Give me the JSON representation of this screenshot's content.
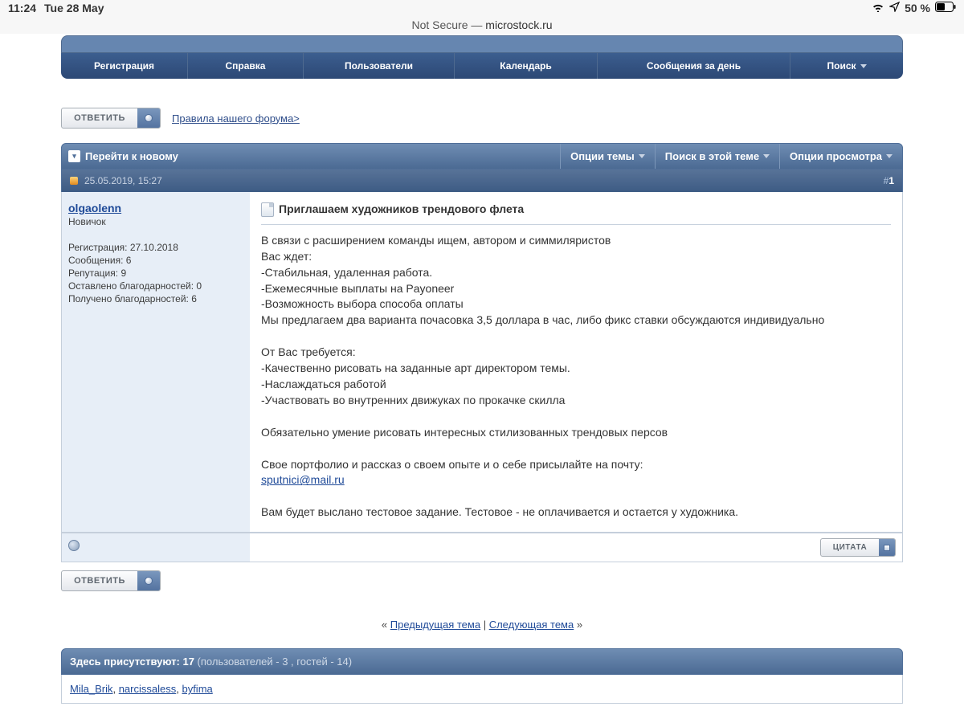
{
  "status_bar": {
    "time": "11:24",
    "date": "Tue 28 May",
    "battery": "50 %"
  },
  "url_bar": {
    "security": "Not Secure — ",
    "domain": "microstock.ru"
  },
  "nav": {
    "registration": "Регистрация",
    "help": "Справка",
    "users": "Пользователи",
    "calendar": "Календарь",
    "daily_posts": "Сообщения за день",
    "search": "Поиск"
  },
  "reply_button": "ОТВЕТИТЬ",
  "rules_link": "Правила нашего форума>",
  "toolbar": {
    "goto_new": "Перейти к новому",
    "thread_options": "Опции темы",
    "search_in_thread": "Поиск в этой теме",
    "view_options": "Опции просмотра"
  },
  "post": {
    "date": "25.05.2019, 15:27",
    "hash": "#",
    "number": "1",
    "user": {
      "name": "olgaolenn",
      "rank": "Новичок",
      "reg_label": "Регистрация: ",
      "reg_val": "27.10.2018",
      "msgs_label": "Сообщения: ",
      "msgs_val": "6",
      "rep_label": "Репутация: ",
      "rep_val": "9",
      "thanks_given_label": "Оставлено благодарностей: ",
      "thanks_given_val": "0",
      "thanks_recv_label": "Получено благодарностей: ",
      "thanks_recv_val": "6"
    },
    "title": "Приглашаем художников трендового флета",
    "body": {
      "l1": "В связи с расширением команды ищем, автором и симмиляристов",
      "l2": "Вас ждет:",
      "l3": "-Стабильная, удаленная работа.",
      "l4": "-Ежемесячные выплаты на Payoneer",
      "l5": "-Возможность выбора способа оплаты",
      "l6": "Мы предлагаем два варианта почасовка 3,5 доллара в час, либо фикс ставки обсуждаются индивидуально",
      "l7": "От Вас требуется:",
      "l8": "-Качественно рисовать на заданные арт директором темы.",
      "l9": "-Наслаждаться работой",
      "l10": "-Участвовать во внутренних движуках по прокачке скилла",
      "l11": "Обязательно умение рисовать интересных стилизованных трендовых персов",
      "l12": "Свое портфолио и рассказ о своем опыте и о себе присылайте на почту:",
      "email": "sputnici@mail.ru",
      "l13": "Вам будет выслано тестовое задание. Тестовое - не оплачивается и остается у художника."
    },
    "quote_button": "ЦИТАТА"
  },
  "thread_nav": {
    "left_arrows": "«",
    "prev": "Предыдущая тема",
    "sep": " | ",
    "next": "Следующая тема",
    "right_arrows": "»"
  },
  "presence": {
    "label": "Здесь присутствуют: ",
    "count": "17",
    "detail": " (пользователей - 3 , гостей - 14)",
    "users": [
      "Mila_Brik",
      "narcissaless",
      "byfima"
    ]
  }
}
